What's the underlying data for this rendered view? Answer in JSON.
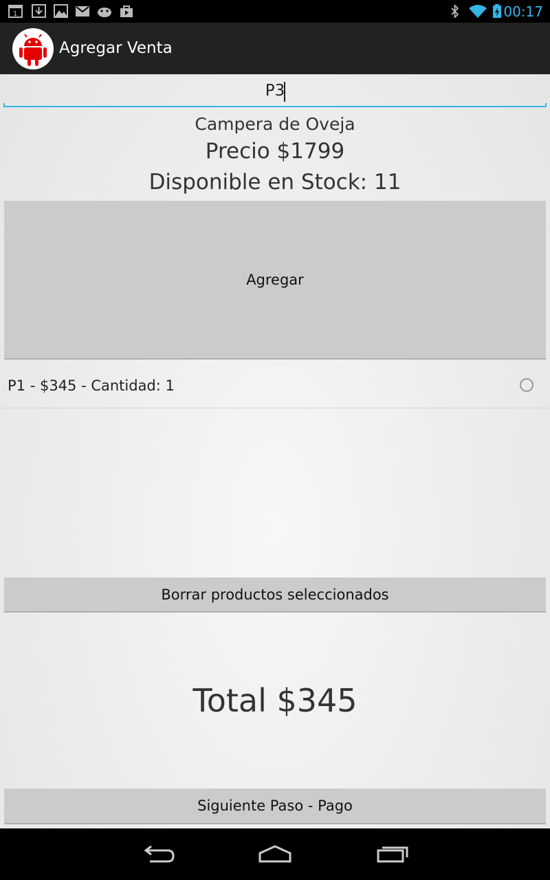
{
  "status_bar": {
    "clock": "00:17",
    "left_icons": [
      "calendar-icon",
      "download-icon",
      "image-icon",
      "gmail-icon",
      "android-debug-icon",
      "store-bag-icon"
    ],
    "right_icons": [
      "bluetooth-icon",
      "wifi-icon",
      "battery-charging-icon"
    ],
    "accent_color": "#33b5e5"
  },
  "action_bar": {
    "title": "Agregar Venta",
    "app_icon": "android-robot-icon",
    "icon_color": "#e60000"
  },
  "search": {
    "value": "P3"
  },
  "product": {
    "name": "Campera de Oveja",
    "price": "Precio $1799",
    "stock": "Disponible en Stock: 11"
  },
  "buttons": {
    "add": "Agregar",
    "delete_selected": "Borrar productos seleccionados",
    "next_step": "Siguiente Paso - Pago"
  },
  "cart": {
    "items": [
      {
        "label": "P1 - $345 - Cantidad: 1",
        "selected": false
      }
    ]
  },
  "total": "Total $345",
  "nav_bar": {
    "icons": [
      "back-icon",
      "home-icon",
      "recent-apps-icon"
    ]
  }
}
